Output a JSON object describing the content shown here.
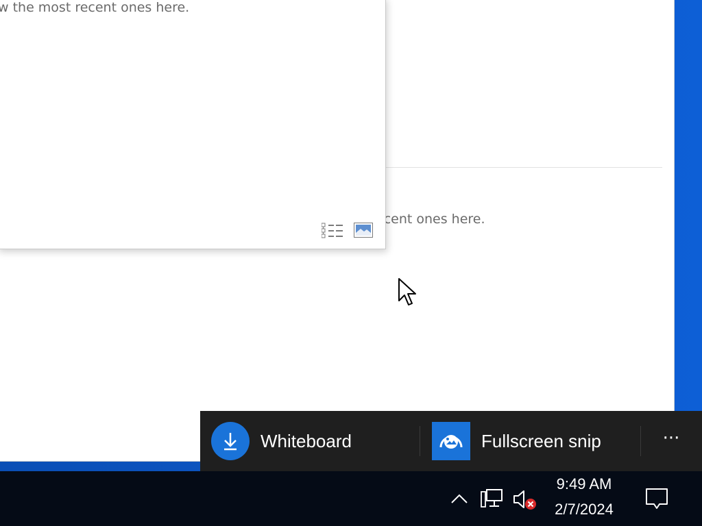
{
  "back_window": {
    "partial_text": "ecent ones here."
  },
  "front_window": {
    "partial_text": "w the most recent ones here.",
    "view_buttons": [
      "details-view-icon",
      "preview-view-icon"
    ]
  },
  "snip_bar": {
    "items": [
      {
        "label": "Whiteboard",
        "icon": "download-arrow-icon"
      },
      {
        "label": "Fullscreen snip",
        "icon": "fullscreen-snip-icon"
      }
    ],
    "more_label": "···"
  },
  "taskbar": {
    "clock": {
      "time": "9:49 AM",
      "date": "2/7/2024"
    },
    "tray_icons": [
      "chevron-up-icon",
      "network-icon",
      "volume-muted-icon",
      "notifications-icon"
    ]
  },
  "colors": {
    "accent": "#1a73d9",
    "snip_bar_bg": "#1f1f1f",
    "taskbar_bg": "#050b16",
    "desktop": "#0d5fd6"
  }
}
